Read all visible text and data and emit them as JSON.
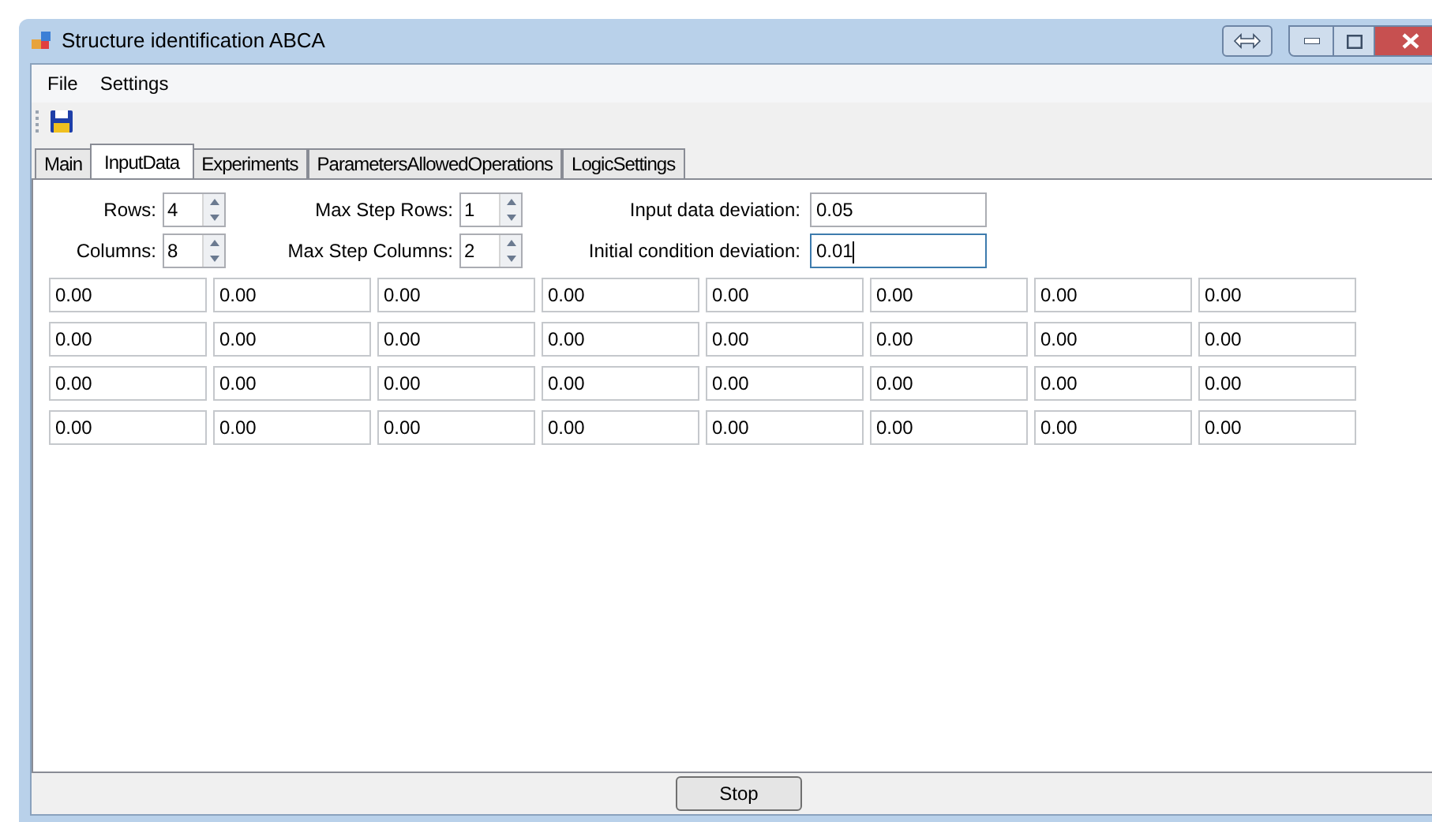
{
  "window": {
    "title": "Structure identification ABCA"
  },
  "menu": [
    "File",
    "Settings"
  ],
  "tabs": [
    {
      "label": "Main",
      "selected": false
    },
    {
      "label": "InputData",
      "selected": true
    },
    {
      "label": "Experiments",
      "selected": false
    },
    {
      "label": "ParametersAllowedOperations",
      "selected": false
    },
    {
      "label": "LogicSettings",
      "selected": false
    }
  ],
  "spinners": [
    {
      "label": "Rows:",
      "value": "4"
    },
    {
      "label": "Max Step Rows:",
      "value": "1"
    },
    {
      "label": "Columns:",
      "value": "8"
    },
    {
      "label": "Max Step Columns:",
      "value": "2"
    }
  ],
  "deviations": [
    {
      "label": "Input data deviation:",
      "value": "0.05",
      "focused": false
    },
    {
      "label": "Initial condition deviation:",
      "value": "0.01",
      "focused": true
    }
  ],
  "grid": [
    [
      "0.00",
      "0.00",
      "0.00",
      "0.00",
      "0.00",
      "0.00",
      "0.00",
      "0.00"
    ],
    [
      "0.00",
      "0.00",
      "0.00",
      "0.00",
      "0.00",
      "0.00",
      "0.00",
      "0.00"
    ],
    [
      "0.00",
      "0.00",
      "0.00",
      "0.00",
      "0.00",
      "0.00",
      "0.00",
      "0.00"
    ],
    [
      "0.00",
      "0.00",
      "0.00",
      "0.00",
      "0.00",
      "0.00",
      "0.00",
      "0.00"
    ]
  ],
  "stop_button": "Stop"
}
